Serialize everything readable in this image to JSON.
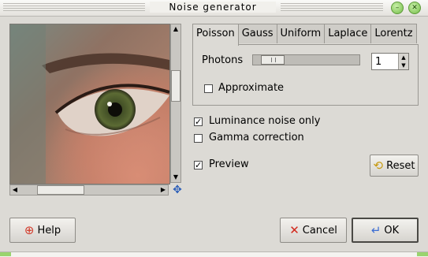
{
  "window": {
    "title": "Noise generator"
  },
  "tabs": [
    "Poisson",
    "Gauss",
    "Uniform",
    "Laplace",
    "Lorentz"
  ],
  "poisson": {
    "photons_label": "Photons",
    "photons_value": "1",
    "approximate_label": "Approximate",
    "approximate_checked": false
  },
  "options": {
    "luminance_label": "Luminance noise only",
    "gamma_label": "Gamma correction",
    "preview_label": "Preview"
  },
  "buttons": {
    "reset": "Reset",
    "help": "Help",
    "cancel": "Cancel",
    "ok": "OK"
  }
}
